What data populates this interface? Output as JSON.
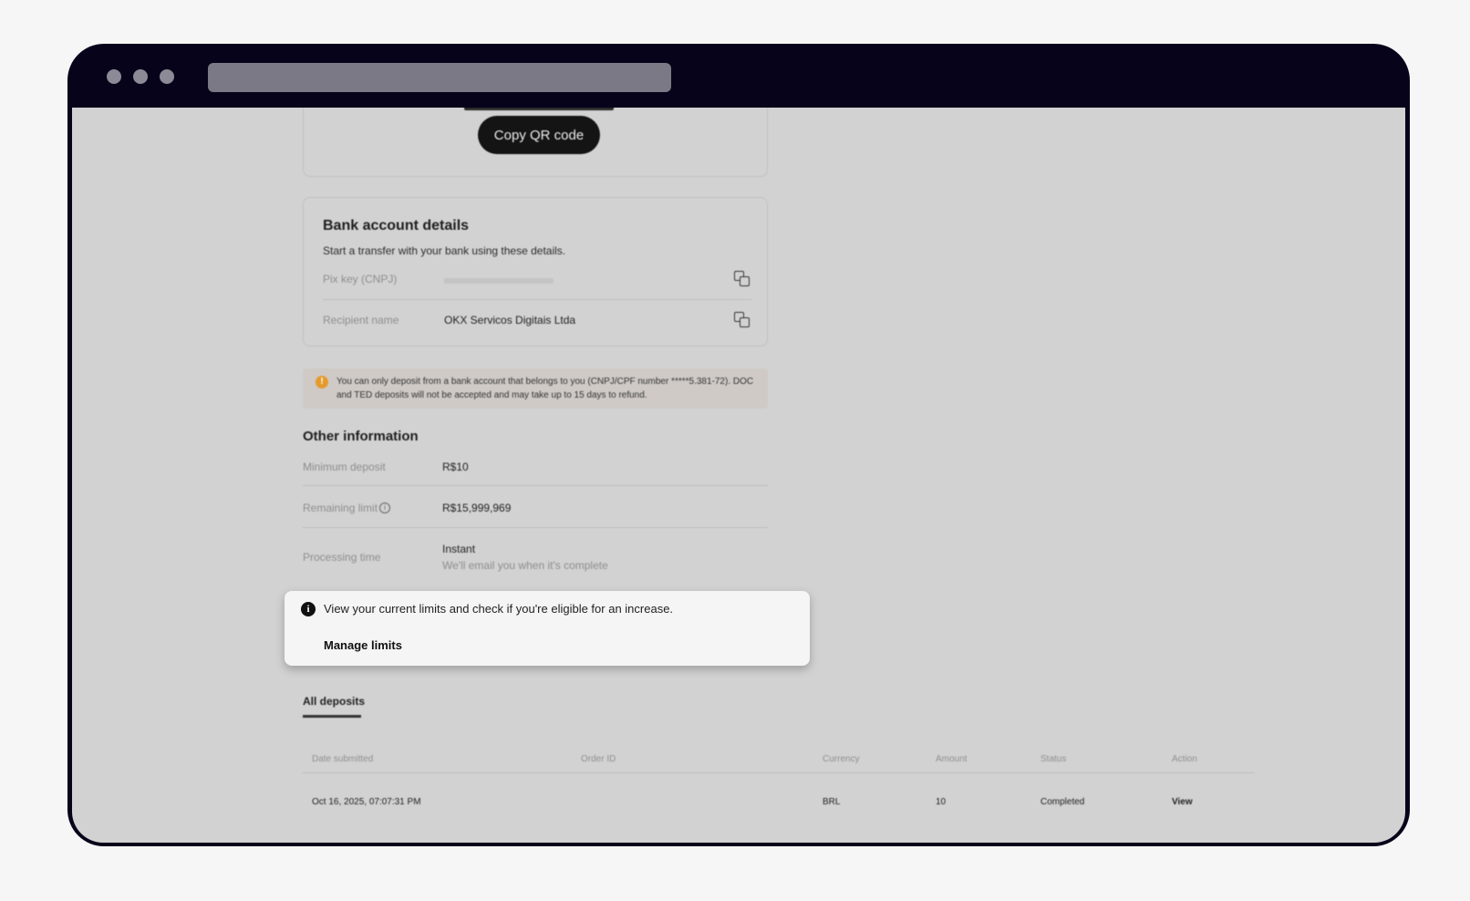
{
  "qr_card": {
    "copy_button": "Copy QR code"
  },
  "bank": {
    "title": "Bank account details",
    "subtitle": "Start a transfer with your bank using these details.",
    "rows": [
      {
        "label": "Pix key (CNPJ)",
        "value": ""
      },
      {
        "label": "Recipient name",
        "value": "OKX Servicos Digitais Ltda"
      }
    ]
  },
  "warning": {
    "text": "You can only deposit from a bank account that belongs to you (CNPJ/CPF number *****5.381-72). DOC and TED deposits will not be accepted and may take up to 15 days to refund."
  },
  "other": {
    "title": "Other information",
    "rows": [
      {
        "label": "Minimum deposit",
        "value": "R$10"
      },
      {
        "label": "Remaining limit",
        "value": "R$15,999,969"
      },
      {
        "label": "Processing time",
        "value": "Instant",
        "sub": "We'll email you when it's complete"
      }
    ]
  },
  "tooltip": {
    "text": "View your current limits and check if you're eligible for an increase.",
    "link": "Manage limits"
  },
  "deposits": {
    "tab": "All deposits",
    "columns": [
      "Date submitted",
      "Order ID",
      "Currency",
      "Amount",
      "Status",
      "Action"
    ],
    "rows": [
      [
        "Oct 16, 2025, 07:07:31 PM",
        "",
        "BRL",
        "10",
        "Completed",
        "View"
      ]
    ]
  }
}
